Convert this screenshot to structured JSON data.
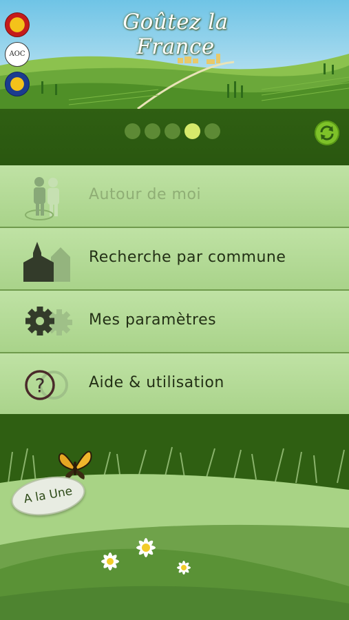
{
  "header": {
    "title": "Goûtez la France",
    "badges": [
      {
        "name": "aop-badge"
      },
      {
        "name": "aoc-badge",
        "text": "AOC"
      },
      {
        "name": "igp-badge"
      }
    ]
  },
  "pager": {
    "page_count": 5,
    "active_index": 3
  },
  "menu": {
    "items": [
      {
        "label": "Autour de moi",
        "icon": "person-location-icon",
        "enabled": false
      },
      {
        "label": "Recherche par commune",
        "icon": "church-icon",
        "enabled": true
      },
      {
        "label": "Mes paramètres",
        "icon": "gear-icon",
        "enabled": true
      },
      {
        "label": "Aide & utilisation",
        "icon": "help-question-icon",
        "enabled": true
      }
    ]
  },
  "footer": {
    "a_la_une_label": "A la Une"
  },
  "colors": {
    "dark_green": "#2f5f12",
    "menu_green": "#b3d995",
    "pager_active": "#d6ea6b",
    "refresh_green": "#7ec229"
  }
}
